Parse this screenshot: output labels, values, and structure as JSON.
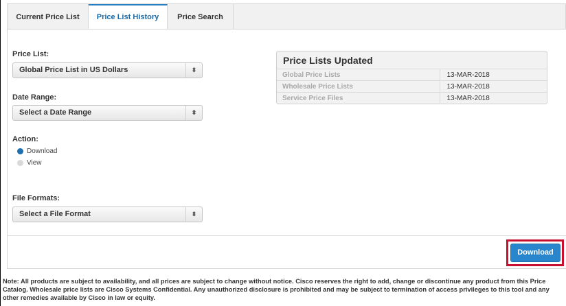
{
  "tabs": [
    {
      "label": "Current Price List",
      "active": false
    },
    {
      "label": "Price List History",
      "active": true
    },
    {
      "label": "Price Search",
      "active": false
    }
  ],
  "form": {
    "price_list_label": "Price List:",
    "price_list_value": "Global Price List in US Dollars",
    "date_range_label": "Date Range:",
    "date_range_value": "Select a Date Range",
    "action_label": "Action:",
    "action_options": [
      {
        "label": "Download",
        "selected": true
      },
      {
        "label": "View",
        "selected": false
      }
    ],
    "file_formats_label": "File Formats:",
    "file_formats_value": "Select a File Format",
    "select_arrow_glyph": "⬍"
  },
  "updated_panel": {
    "title": "Price Lists Updated",
    "rows": [
      {
        "name": "Global Price Lists",
        "date": "13-MAR-2018"
      },
      {
        "name": "Wholesale Price Lists",
        "date": "13-MAR-2018"
      },
      {
        "name": "Service Price Files",
        "date": "13-MAR-2018"
      }
    ]
  },
  "download_button": {
    "label": "Download"
  },
  "note": "Note: All products are subject to availability, and all prices are subject to change without notice. Cisco reserves the right to add, change or discontinue any product from this Price Catalog. Wholesale price lists are Cisco Systems Confidential. Any unauthorized disclosure is prohibited and may be subject to termination of access privileges to this tool and any other remedies available by Cisco in law or equity.",
  "colors": {
    "accent": "#2a86cc",
    "highlight": "#c8102e",
    "active_tab_text": "#1a6aa8"
  }
}
